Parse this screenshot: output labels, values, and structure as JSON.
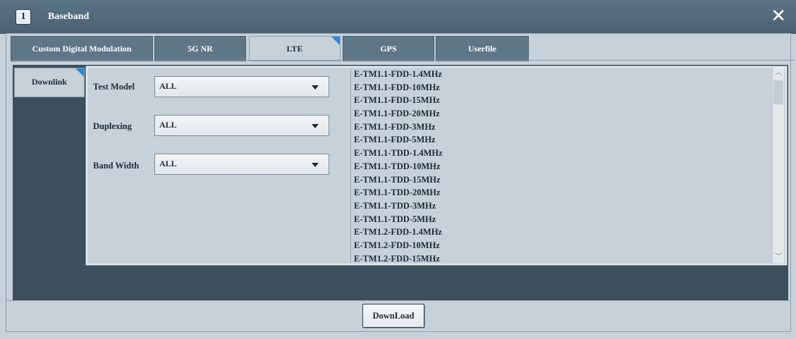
{
  "window": {
    "number": "1",
    "title": "Baseband",
    "close_glyph": "✕"
  },
  "tabs": [
    {
      "label": "Custom Digital Modulation",
      "active": false
    },
    {
      "label": "5G NR",
      "active": false
    },
    {
      "label": "LTE",
      "active": true
    },
    {
      "label": "GPS",
      "active": false
    },
    {
      "label": "Userfile",
      "active": false
    }
  ],
  "sub_tab": {
    "label": "Downlink"
  },
  "form": {
    "test_model": {
      "label": "Test Model",
      "value": "ALL"
    },
    "duplexing": {
      "label": "Duplexing",
      "value": "ALL"
    },
    "band_width": {
      "label": "Band Width",
      "value": "ALL"
    }
  },
  "models": [
    "E-TM1.1-FDD-1.4MHz",
    "E-TM1.1-FDD-10MHz",
    "E-TM1.1-FDD-15MHz",
    "E-TM1.1-FDD-20MHz",
    "E-TM1.1-FDD-3MHz",
    "E-TM1.1-FDD-5MHz",
    "E-TM1.1-TDD-1.4MHz",
    "E-TM1.1-TDD-10MHz",
    "E-TM1.1-TDD-15MHz",
    "E-TM1.1-TDD-20MHz",
    "E-TM1.1-TDD-3MHz",
    "E-TM1.1-TDD-5MHz",
    "E-TM1.2-FDD-1.4MHz",
    "E-TM1.2-FDD-10MHz",
    "E-TM1.2-FDD-15MHz"
  ],
  "scroll": {
    "up": "︿",
    "down": "﹀"
  },
  "download": {
    "label": "DownLoad"
  },
  "colors": {
    "accent": "#2e87d8",
    "titlebar": "#4f6779",
    "tab": "#5e7787"
  }
}
